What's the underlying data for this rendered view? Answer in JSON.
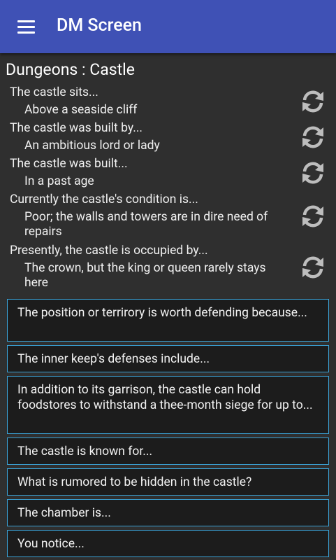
{
  "appbar": {
    "title": "DM Screen",
    "menu_icon": "hamburger-menu-icon",
    "color": "#3f51b5"
  },
  "section_title": "Dungeons : Castle",
  "generators": [
    {
      "question": "The castle sits...",
      "answer": "Above a seaside cliff"
    },
    {
      "question": "The castle was built by...",
      "answer": "An ambitious lord or lady"
    },
    {
      "question": "The castle was built...",
      "answer": "In a past age"
    },
    {
      "question": "Currently the castle's condition is...",
      "answer": "Poor; the walls and towers are in dire need of repairs"
    },
    {
      "question": "Presently, the castle is occupied by...",
      "answer": "The crown, but the king or queen rarely stays here"
    }
  ],
  "prompts": [
    "The position or terrirory is worth defending because...",
    "The inner keep's defenses include...",
    "In addition to its garrison, the castle can hold foodstores to withstand a thee-month siege for up to...",
    "The castle is known for...",
    "What is rumored to be hidden in the castle?",
    "The chamber is...",
    "You notice..."
  ],
  "colors": {
    "background": "#2f2f2f",
    "card_border": "#3aa2d6",
    "card_bg": "#1c1c1c"
  }
}
